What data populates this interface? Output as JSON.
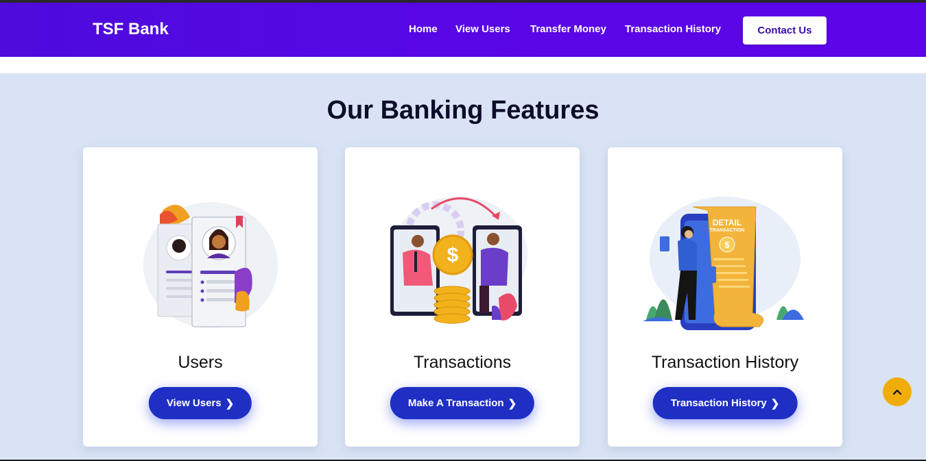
{
  "header": {
    "brand": "TSF Bank",
    "nav": [
      "Home",
      "View Users",
      "Transfer Money",
      "Transaction History"
    ],
    "contact_label": "Contact Us"
  },
  "features": {
    "title": "Our Banking Features",
    "cards": [
      {
        "title": "Users",
        "button": "View Users",
        "icon": "users-profile-cards-illustration"
      },
      {
        "title": "Transactions",
        "button": "Make A Transaction",
        "icon": "money-transfer-illustration"
      },
      {
        "title": "Transaction History",
        "button": "Transaction History",
        "icon": "detail-transaction-receipt-illustration"
      }
    ],
    "receipt_text": [
      "DETAIL",
      "TRANSACTION"
    ]
  },
  "colors": {
    "navbar": "#5a06e6",
    "button": "#1f2fc4",
    "section_bg": "#d9e3f5",
    "scroll_top": "#f0ad0a"
  },
  "scroll_top_icon": "chevron-up-icon"
}
